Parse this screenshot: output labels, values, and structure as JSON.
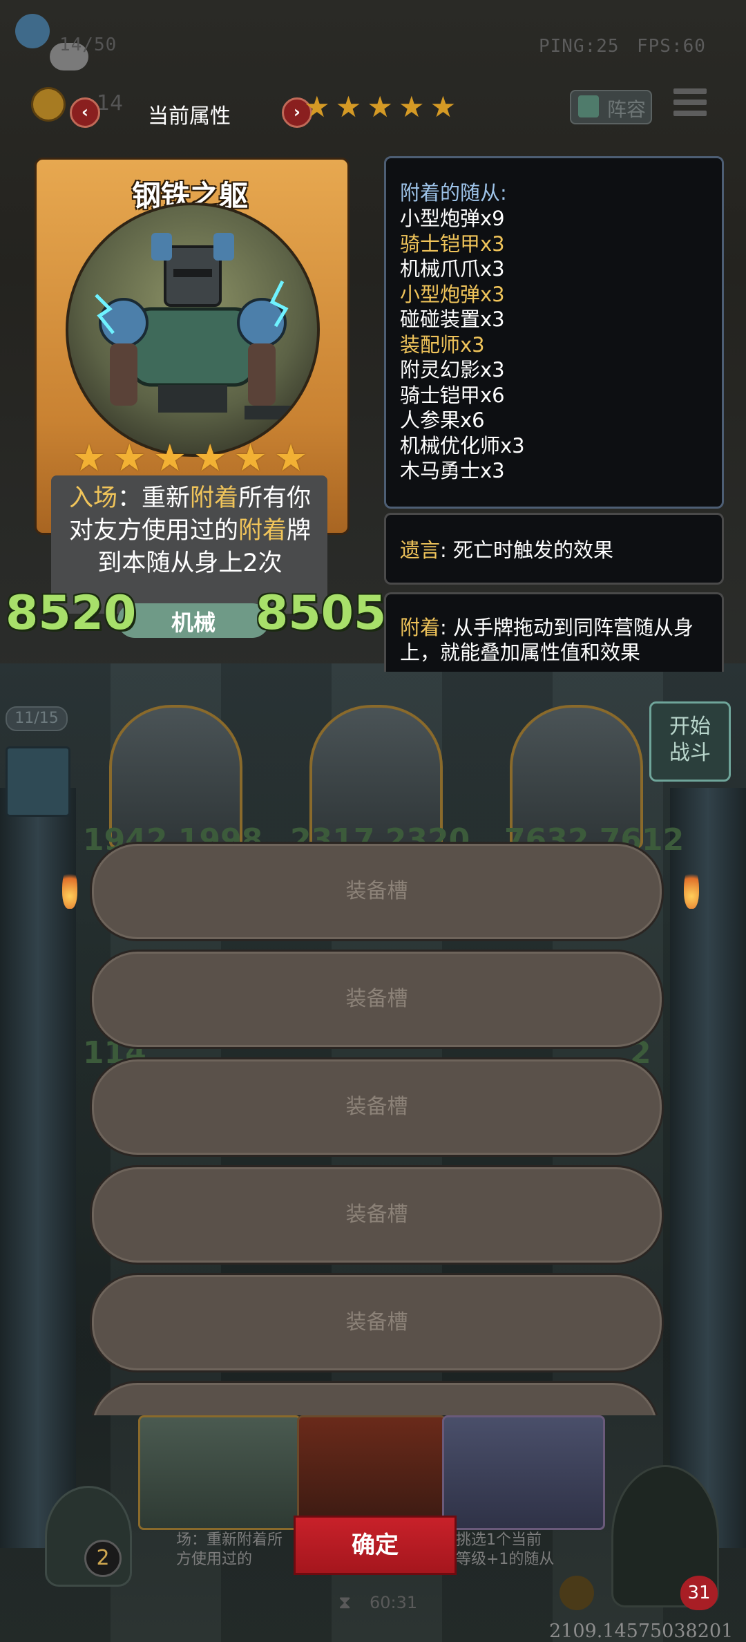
{
  "hud": {
    "counter": "14/50",
    "ping": "PING:25",
    "fps": "FPS:60",
    "gold": "14",
    "lineup_label": "阵容"
  },
  "attributes_nav": {
    "title": "当前属性",
    "prev": "‹",
    "next": "›",
    "stars": [
      "★",
      "★",
      "★",
      "★",
      "★",
      "★"
    ]
  },
  "card": {
    "name": "钢铁之躯",
    "stars": [
      "★",
      "★",
      "★",
      "★",
      "★",
      "★"
    ],
    "desc_segments": {
      "line1_a": "入场",
      "line1_b": "：重新",
      "line1_c": "附着",
      "line1_d": "所有你",
      "line2_a": "对友方使用过的",
      "line2_b": "附着",
      "line2_c": "牌",
      "line3": "到本随从身上2次"
    },
    "attack": "8520",
    "tribe": "机械",
    "health": "8505"
  },
  "attached_panel": {
    "heading": "附着的随从:",
    "items": [
      {
        "text": "小型炮弹x9",
        "color": "#ffffff"
      },
      {
        "text": "骑士铠甲x3",
        "color": "#f0c45a"
      },
      {
        "text": "机械爪爪x3",
        "color": "#ffffff"
      },
      {
        "text": "小型炮弹x3",
        "color": "#f0c45a"
      },
      {
        "text": "碰碰装置x3",
        "color": "#ffffff"
      },
      {
        "text": "装配师x3",
        "color": "#f0c45a"
      },
      {
        "text": "附灵幻影x3",
        "color": "#ffffff"
      },
      {
        "text": "骑士铠甲x6",
        "color": "#ffffff"
      },
      {
        "text": "人参果x6",
        "color": "#ffffff"
      },
      {
        "text": "机械优化师x3",
        "color": "#ffffff"
      },
      {
        "text": "木马勇士x3",
        "color": "#ffffff"
      }
    ]
  },
  "keyword_deathrattle": {
    "keyword": "遗言",
    "text": ": 死亡时触发的效果"
  },
  "keyword_attach": {
    "keyword": "附着",
    "text": ": 从手牌拖动到同阵营随从身上，就能叠加属性值和效果"
  },
  "board": {
    "shop_count": "11/15",
    "start_battle": "开始战斗",
    "stat_row1": [
      "1942 1998",
      "2317 2320",
      "7632 7612"
    ],
    "stat_row2": [
      "114",
      "2"
    ]
  },
  "equip_slots": [
    "装备槽",
    "装备槽",
    "装备槽",
    "装备槽",
    "装备槽"
  ],
  "bottom": {
    "confirm": "确定",
    "timer": "60:31",
    "hero_count": "2",
    "health": "31",
    "coords": "2109.14575038201",
    "hand_text_1": "场：重新附着所",
    "hand_text_2": "方使用过的",
    "hand_text_3": "挑选1个当前",
    "hand_text_4": "等级+1的随从"
  },
  "colors": {
    "gold_text": "#f0c45a",
    "stat_green": "#a8e06a",
    "panel_border": "#4d5e74",
    "confirm_red": "#c8212a"
  }
}
